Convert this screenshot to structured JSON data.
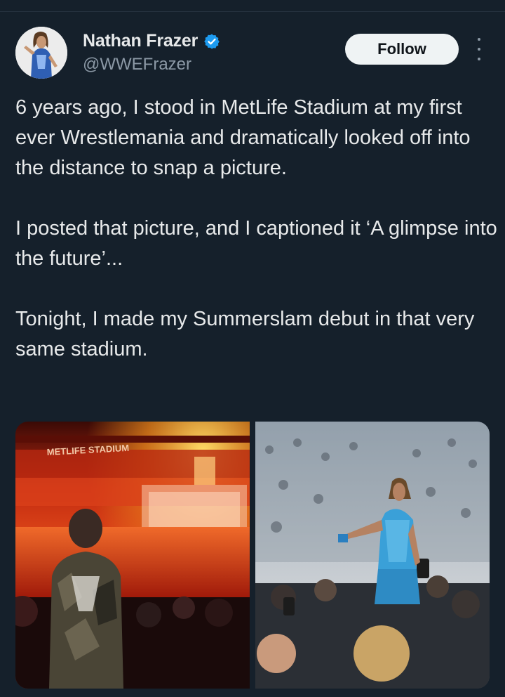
{
  "author": {
    "name": "Nathan Frazer",
    "handle": "@WWEFrazer",
    "verified_icon": "verified-badge-icon",
    "verified_color": "#1d9bf0"
  },
  "actions": {
    "follow_label": "Follow",
    "more_icon": "more-vertical-icon"
  },
  "tweet": {
    "paragraphs": [
      "6 years ago, I stood in MetLife Stadium at my first ever Wrestlemania and dramatically looked off into the distance to snap a picture.",
      "I posted that picture, and I captioned it ‘A glimpse into the future’...",
      "Tonight, I made my Summerslam debut in that very same stadium."
    ]
  },
  "media": {
    "photo_1": {
      "sign_text": "METLIFE STADIUM"
    }
  },
  "colors": {
    "background": "#15202b",
    "text": "#e7e9ea",
    "secondary_text": "#8b98a5",
    "follow_bg": "#eff3f4"
  }
}
